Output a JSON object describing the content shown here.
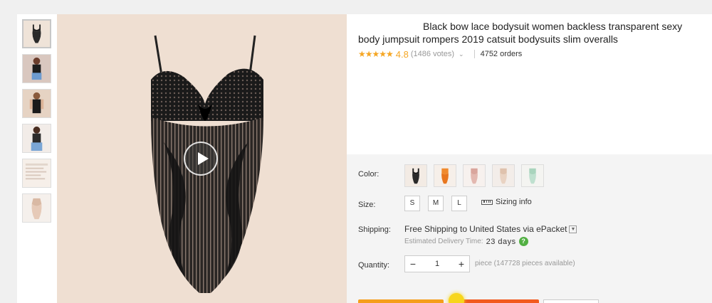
{
  "product": {
    "title": "Black bow lace bodysuit women backless transparent sexy body jumpsuit rompers 2019 catsuit bodysuits slim overalls",
    "stars": "★★★★★",
    "rating": "4.8",
    "votes": "(1486 votes)",
    "orders": "4752 orders"
  },
  "specs": {
    "color_label": "Color:",
    "size_label": "Size:",
    "sizes": [
      "S",
      "M",
      "L"
    ],
    "sizing_info": "Sizing info",
    "shipping_label": "Shipping:",
    "shipping_free": "Free Shipping to",
    "shipping_dest": "United States via ePacket",
    "delivery_label": "Estimated Delivery Time:",
    "delivery_days": "23 days",
    "help": "?",
    "quantity_label": "Quantity:",
    "qty_minus": "−",
    "qty_value": "1",
    "qty_plus": "+",
    "piece": "piece (147728 pieces available)"
  },
  "colors": {
    "background": "#f0f0f0",
    "image_bg": "#efdfd2",
    "star": "#f5a623",
    "buy_now": "#f59e1b",
    "add_to_cart": "#f25a1e",
    "help": "#52b043"
  }
}
